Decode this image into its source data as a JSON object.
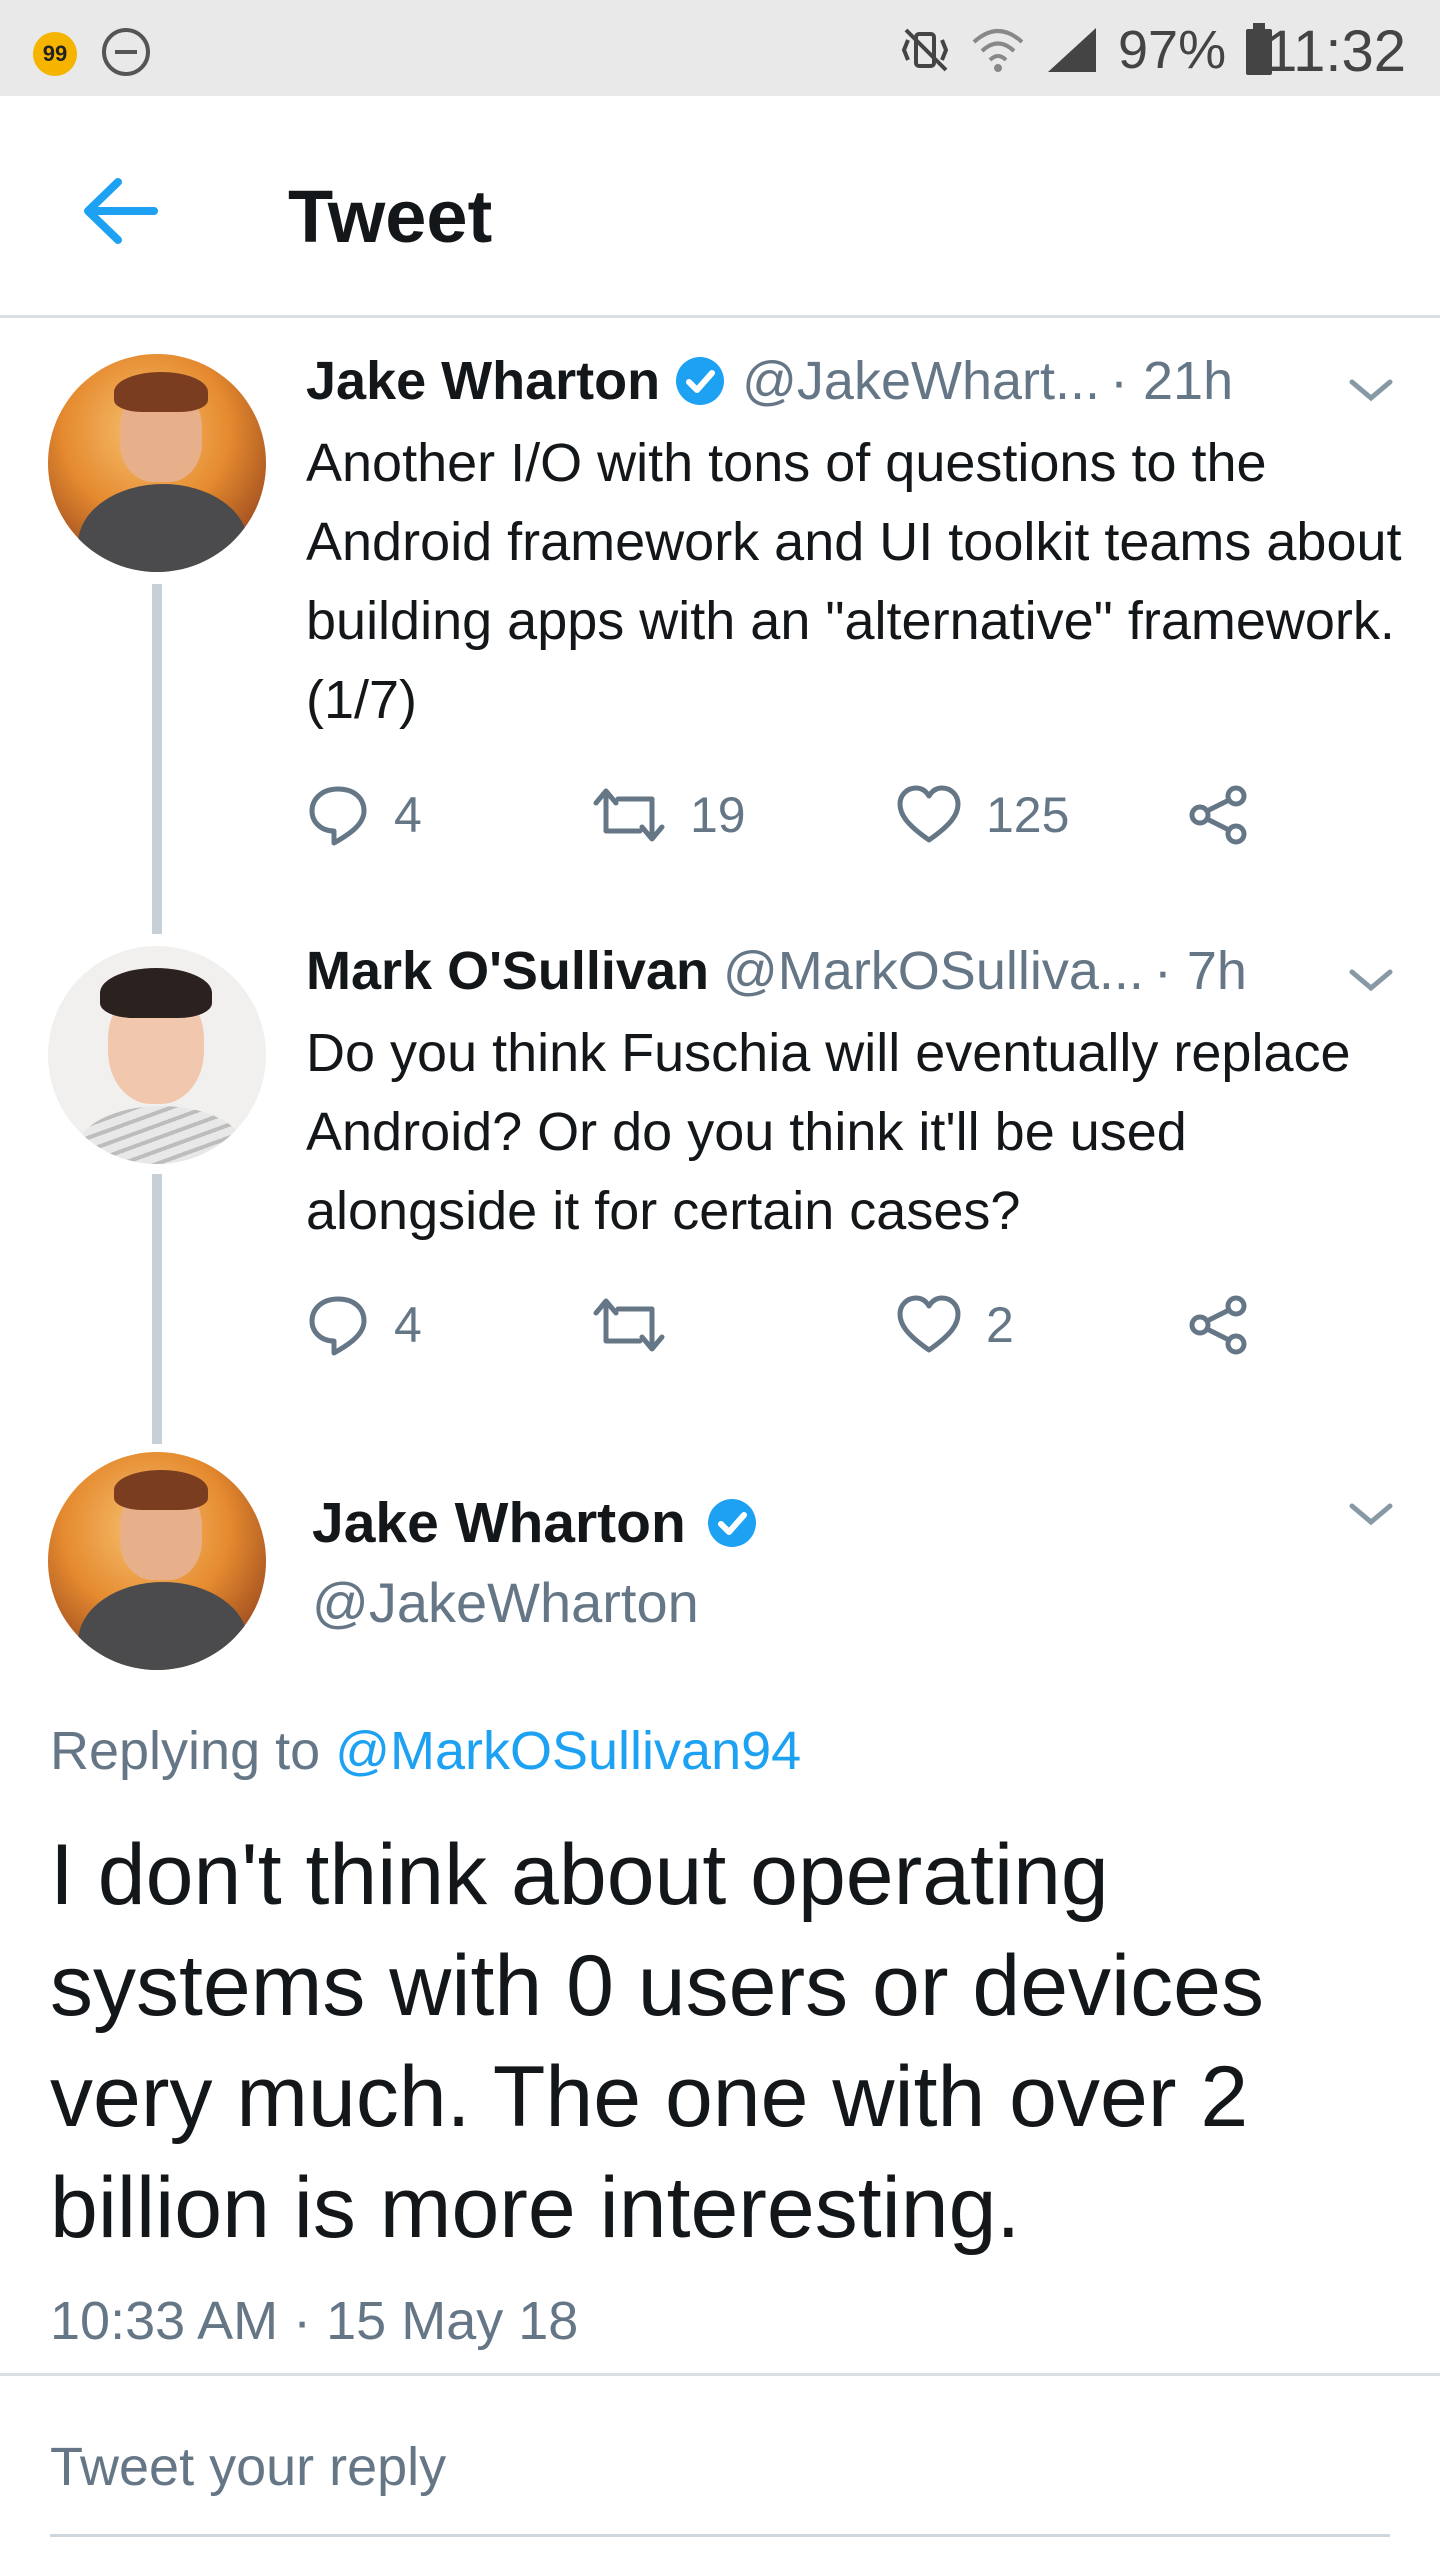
{
  "status_bar": {
    "badge": "99",
    "battery": "97%",
    "time": "11:32",
    "icons": [
      "notification-badge-icon",
      "do-not-disturb-icon",
      "mute-vibrate-icon",
      "wifi-icon",
      "signal-icon",
      "battery-icon"
    ]
  },
  "app_bar": {
    "title": "Tweet",
    "back_icon": "arrow-left-icon"
  },
  "colors": {
    "accent": "#1da1f2",
    "muted": "#657786",
    "text": "#14171a"
  },
  "thread": [
    {
      "name": "Jake Wharton",
      "verified": true,
      "handle": "@JakeWhart...",
      "time": "· 21h",
      "text": "Another I/O with tons of questions to the Android framework and UI toolkit teams about building apps with an \"alternative\" framework. (1/7)",
      "replies": "4",
      "retweets": "19",
      "likes": "125"
    },
    {
      "name": "Mark O'Sullivan",
      "verified": false,
      "handle": "@MarkOSulliva...",
      "time": "· 7h",
      "text": "Do you think Fuschia will eventually replace Android? Or do you think it'll be used alongside it for certain cases?",
      "replies": "4",
      "retweets": "",
      "likes": "2"
    }
  ],
  "main_tweet": {
    "name": "Jake Wharton",
    "verified": true,
    "handle": "@JakeWharton",
    "replying_prefix": "Replying to",
    "replying_to": "@MarkOSullivan94",
    "text": "I don't think about operating systems with 0 users or devices very much. The one with over 2 billion is more interesting.",
    "timestamp": "10:33 AM · 15 May 18"
  },
  "reply_input": {
    "placeholder": "Tweet your reply"
  }
}
